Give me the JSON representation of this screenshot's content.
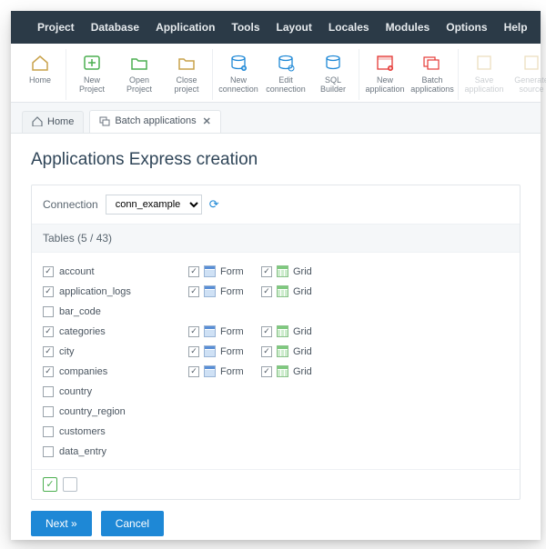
{
  "menu": [
    "Project",
    "Database",
    "Application",
    "Tools",
    "Layout",
    "Locales",
    "Modules",
    "Options",
    "Help"
  ],
  "toolbar": {
    "home": "Home",
    "new_project": "New Project",
    "open_project": "Open Project",
    "close_project": "Close project",
    "new_connection": "New connection",
    "edit_connection": "Edit connection",
    "sql_builder": "SQL Builder",
    "new_application": "New application",
    "batch_applications": "Batch applications",
    "save_application": "Save application",
    "generate_source": "Generate source"
  },
  "tabs": {
    "home": "Home",
    "batch": "Batch applications"
  },
  "page_title": "Applications Express creation",
  "connection": {
    "label": "Connection",
    "selected": "conn_example"
  },
  "tables_header": "Tables (5 / 43)",
  "form_label": "Form",
  "grid_label": "Grid",
  "rows": [
    {
      "name": "account",
      "checked": true,
      "form": true,
      "grid": true
    },
    {
      "name": "application_logs",
      "checked": true,
      "form": true,
      "grid": true
    },
    {
      "name": "bar_code",
      "checked": false
    },
    {
      "name": "categories",
      "checked": true,
      "form": true,
      "grid": true
    },
    {
      "name": "city",
      "checked": true,
      "form": true,
      "grid": true
    },
    {
      "name": "companies",
      "checked": true,
      "form": true,
      "grid": true
    },
    {
      "name": "country",
      "checked": false
    },
    {
      "name": "country_region",
      "checked": false
    },
    {
      "name": "customers",
      "checked": false
    },
    {
      "name": "data_entry",
      "checked": false
    }
  ],
  "buttons": {
    "next": "Next »",
    "cancel": "Cancel"
  }
}
